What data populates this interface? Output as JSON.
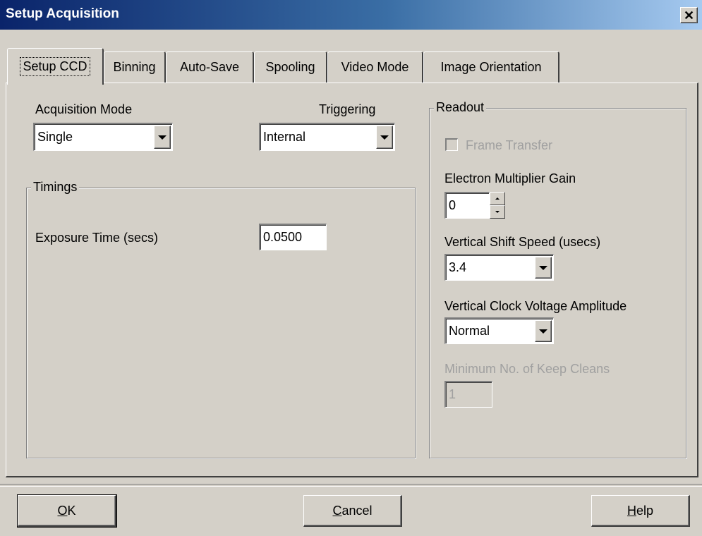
{
  "window": {
    "title": "Setup Acquisition",
    "close_glyph": "✕"
  },
  "tabs": [
    {
      "label": "Setup CCD",
      "active": true
    },
    {
      "label": "Binning"
    },
    {
      "label": "Auto-Save"
    },
    {
      "label": "Spooling"
    },
    {
      "label": "Video Mode"
    },
    {
      "label": "Image Orientation"
    }
  ],
  "acquisition_mode": {
    "label": "Acquisition Mode",
    "value": "Single"
  },
  "triggering": {
    "label": "Triggering",
    "value": "Internal"
  },
  "timings": {
    "title": "Timings",
    "exposure_label": "Exposure Time (secs)",
    "exposure_value": "0.0500"
  },
  "readout": {
    "title": "Readout",
    "frame_transfer_label": "Frame Transfer",
    "emg_label": "Electron Multiplier Gain",
    "emg_value": "0",
    "vss_label": "Vertical Shift Speed (usecs)",
    "vss_value": "3.4",
    "vcva_label": "Vertical Clock Voltage Amplitude",
    "vcva_value": "Normal",
    "keep_cleans_label": "Minimum No. of Keep Cleans",
    "keep_cleans_value": "1"
  },
  "buttons": {
    "ok_mnemonic": "O",
    "ok_rest": "K",
    "cancel_mnemonic": "C",
    "cancel_rest": "ancel",
    "help_mnemonic": "H",
    "help_rest": "elp"
  }
}
